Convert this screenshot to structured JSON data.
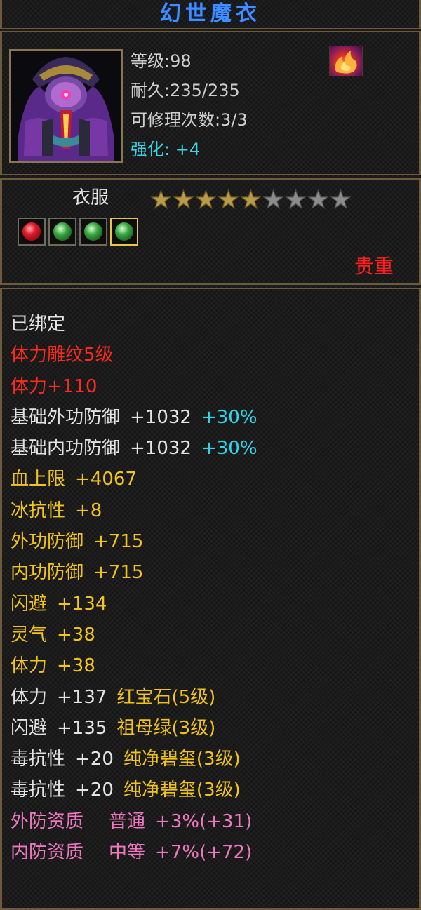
{
  "item": {
    "name": "幻世魔衣",
    "level": "等级:98",
    "durability": "耐久:235/235",
    "repair": "可修理次数:3/3",
    "enhance_label": "强化:",
    "enhance_value": "+4",
    "type": "衣服",
    "stars_filled": 5,
    "stars_total": 9,
    "rarity": "贵重",
    "gems": [
      "ruby",
      "emerald",
      "emerald",
      "emerald"
    ],
    "gem_selected_index": 3
  },
  "attributes": {
    "bound": "已绑定",
    "engrave": "体力雕纹5级",
    "vit_bonus": "体力+110",
    "ext_def_base": {
      "name": "基础外功防御",
      "value": "+1032",
      "pct": "+30%"
    },
    "int_def_base": {
      "name": "基础内功防御",
      "value": "+1032",
      "pct": "+30%"
    },
    "hp_max": {
      "name": "血上限",
      "value": "+4067"
    },
    "ice_res": {
      "name": "冰抗性",
      "value": "+8"
    },
    "ext_def": {
      "name": "外功防御",
      "value": "+715"
    },
    "int_def": {
      "name": "内功防御",
      "value": "+715"
    },
    "dodge": {
      "name": "闪避",
      "value": "+134"
    },
    "spirit": {
      "name": "灵气",
      "value": "+38"
    },
    "vit": {
      "name": "体力",
      "value": "+38"
    },
    "gem_vit": {
      "name": "体力",
      "value": "+137",
      "gem": "红宝石(5级)"
    },
    "gem_dodge": {
      "name": "闪避",
      "value": "+135",
      "gem": "祖母绿(3级)"
    },
    "gem_poison1": {
      "name": "毒抗性",
      "value": "+20",
      "gem": "纯净碧玺(3级)"
    },
    "gem_poison2": {
      "name": "毒抗性",
      "value": "+20",
      "gem": "纯净碧玺(3级)"
    },
    "ext_quality": {
      "name": "外防资质",
      "grade": "普通",
      "bonus": "+3%(+31)"
    },
    "int_quality": {
      "name": "内防资质",
      "grade": "中等",
      "bonus": "+7%(+72)"
    }
  },
  "colors": {
    "title": "#3f8dff",
    "enhance": "#36d6e8",
    "rarity": "#ff1f1f",
    "attr_red": "#ff2a1e",
    "attr_gold": "#f3c41a",
    "attr_cyan": "#2fd7ea",
    "attr_pink": "#ef78c0",
    "frame": "#6d5a3a"
  },
  "icons": {
    "portrait": "armor-portrait-icon",
    "skill": "flame-skill-icon",
    "star": "star-icon"
  }
}
